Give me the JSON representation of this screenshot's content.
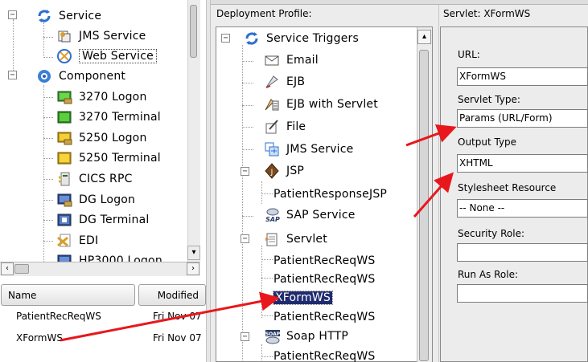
{
  "left_tree": {
    "items": [
      {
        "label": "Service",
        "icon": "refresh-cycle-icon"
      },
      {
        "label": "JMS Service",
        "icon": "jms-service-icon"
      },
      {
        "label": "Web Service",
        "icon": "web-service-icon"
      },
      {
        "label": "Component",
        "icon": "component-gear-icon"
      },
      {
        "label": "3270 Logon",
        "icon": "terminal-logon-icon"
      },
      {
        "label": "3270 Terminal",
        "icon": "terminal-icon"
      },
      {
        "label": "5250 Logon",
        "icon": "terminal-logon-icon"
      },
      {
        "label": "5250 Terminal",
        "icon": "terminal-icon"
      },
      {
        "label": "CICS RPC",
        "icon": "cics-rpc-icon"
      },
      {
        "label": "DG Logon",
        "icon": "dg-logon-icon"
      },
      {
        "label": "DG Terminal",
        "icon": "dg-terminal-icon"
      },
      {
        "label": "EDI",
        "icon": "edi-icon"
      },
      {
        "label": "HP3000 Logon",
        "icon": "hp3000-logon-icon"
      }
    ]
  },
  "left_list": {
    "columns": [
      "Name",
      "Modified"
    ],
    "rows": [
      {
        "name": "PatientRecReqWS",
        "modified": "Fri Nov 07"
      },
      {
        "name": "XFormWS",
        "modified": "Fri Nov 07"
      }
    ]
  },
  "middle": {
    "title": "Deployment Profile:",
    "items": [
      {
        "label": "Service Triggers",
        "icon": "refresh-cycle-icon"
      },
      {
        "label": "Email",
        "icon": "envelope-icon"
      },
      {
        "label": "EJB",
        "icon": "ejb-icon"
      },
      {
        "label": "EJB with Servlet",
        "icon": "ejb-servlet-icon"
      },
      {
        "label": "File",
        "icon": "file-icon"
      },
      {
        "label": "JMS Service",
        "icon": "jms-service-icon"
      },
      {
        "label": "JSP",
        "icon": "jsp-icon"
      },
      {
        "label": "PatientResponseJSP"
      },
      {
        "label": "SAP Service",
        "icon": "sap-icon"
      },
      {
        "label": "Servlet",
        "icon": "servlet-icon"
      },
      {
        "label": "PatientRecReqWS"
      },
      {
        "label": "PatientRecReqWS"
      },
      {
        "label": "XFormWS"
      },
      {
        "label": "PatientRecReqWS"
      },
      {
        "label": "Soap HTTP",
        "icon": "soap-icon"
      },
      {
        "label": "PatientRecReqWS"
      }
    ]
  },
  "right": {
    "title": "Servlet: XFormWS",
    "fields": {
      "url": {
        "label": "URL:",
        "value": "XFormWS"
      },
      "servlet_type": {
        "label": "Servlet Type:",
        "value": "Params (URL/Form)"
      },
      "output_type": {
        "label": "Output Type",
        "value": "XHTML"
      },
      "stylesheet": {
        "label": "Stylesheet Resource",
        "value": "-- None --"
      },
      "security_role": {
        "label": "Security Role:",
        "value": ""
      },
      "run_as_role": {
        "label": "Run As Role:",
        "value": ""
      }
    }
  },
  "colors": {
    "selection": "#1f2b6e",
    "arrow": "#e8171c",
    "panel_bg": "#ececec"
  }
}
